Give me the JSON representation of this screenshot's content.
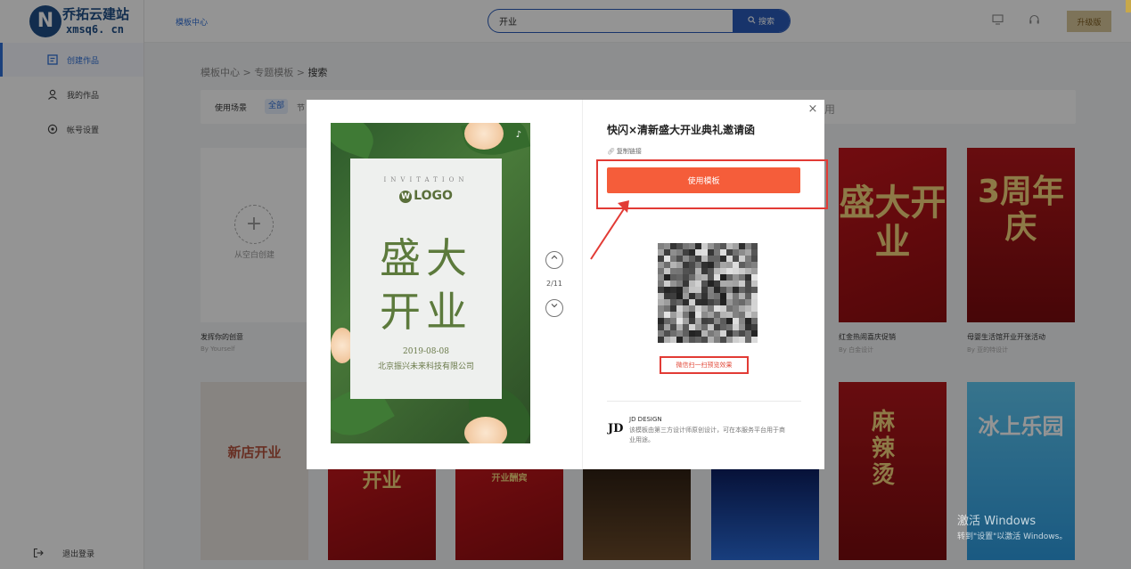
{
  "brand": {
    "name": "乔拓云建站",
    "domain": "xmsq6. cn"
  },
  "sidebar": {
    "items": [
      {
        "label": "创建作品",
        "icon": "edit-icon",
        "active": true
      },
      {
        "label": "我的作品",
        "icon": "user-icon",
        "active": false
      },
      {
        "label": "帐号设置",
        "icon": "settings-icon",
        "active": false
      }
    ],
    "logout": "退出登录"
  },
  "topbar": {
    "link": "模板中心",
    "search_value": "开业",
    "search_button": "搜索",
    "upgrade": "升级版"
  },
  "breadcrumb": {
    "a": "模板中心",
    "sep": ">",
    "b": "专题模板",
    "c": "搜索"
  },
  "filter": {
    "label": "使用场景",
    "active": "全部",
    "more": "节",
    "tail": "用"
  },
  "blank_card": {
    "label": "从空白创建",
    "title": "发挥你的创意",
    "sub": "By Yourself"
  },
  "cards_row1": [
    {
      "title": "红金热闹喜庆促销",
      "sub": "By 白金设计",
      "big": "盛大开业"
    },
    {
      "title": "母婴生活馆开业开张活动",
      "sub": "By 亚的特设计",
      "big": "3周年庆"
    }
  ],
  "cards_row2": [
    {
      "big": "新店开业"
    },
    {
      "big": "开业"
    },
    {
      "big": "开业酬宾"
    },
    {
      "big": ""
    },
    {
      "big": ""
    },
    {
      "big": "麻辣烫"
    },
    {
      "big": "冰上乐园"
    }
  ],
  "modal": {
    "title": "快闪×清新盛大开业典礼邀请函",
    "copy_link": "复制链接",
    "use_button": "使用模板",
    "scan_hint": "微信扫一扫预览效果",
    "pager": "2/11",
    "poster": {
      "invitation": "INVITATION",
      "logo": "LOGO",
      "line1": "盛大",
      "line2": "开业",
      "date": "2019-08-08",
      "company": "北京振兴未来科技有限公司"
    },
    "designer": {
      "mark": "JD",
      "name": "JD DESIGN",
      "desc": "该模板由第三方设计师原创设计，可在本服务平台用于商业用途。"
    }
  },
  "watermark": {
    "line1": "激活 Windows",
    "line2": "转到\"设置\"以激活 Windows。"
  },
  "colors": {
    "accent": "#2a5bb8",
    "primary_button": "#f55d3a",
    "highlight_border": "#e23b35"
  }
}
